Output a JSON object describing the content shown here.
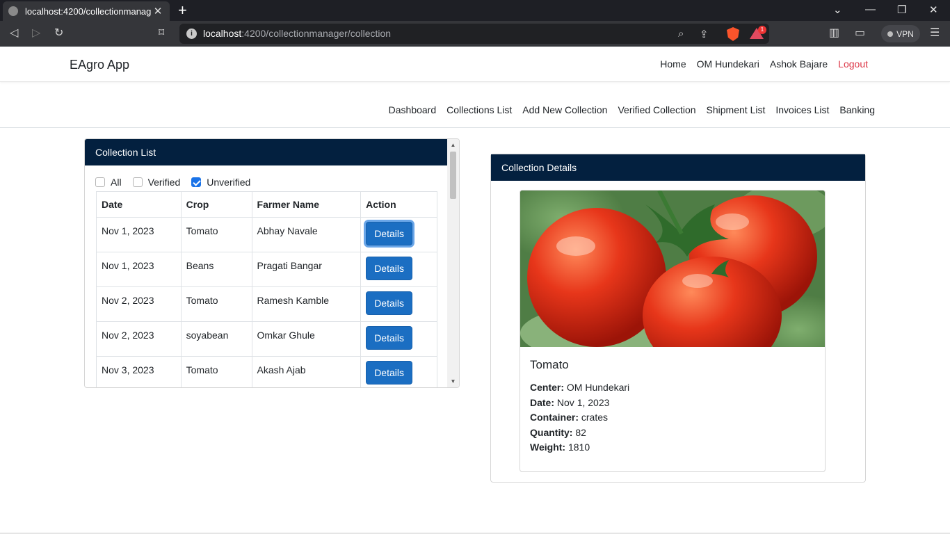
{
  "browser": {
    "tab_title": "localhost:4200/collectionmanage",
    "url_host": "localhost",
    "url_path": ":4200/collectionmanager/collection",
    "vpn_label": "VPN",
    "notification_count": "1"
  },
  "navbar": {
    "brand": "EAgro App",
    "links": [
      "Home",
      "OM Hundekari",
      "Ashok Bajare"
    ],
    "logout": "Logout"
  },
  "subnav": {
    "links": [
      "Dashboard",
      "Collections List",
      "Add New Collection",
      "Verified Collection",
      "Shipment List",
      "Invoices List",
      "Banking"
    ]
  },
  "collection_list": {
    "title": "Collection List",
    "filters": [
      {
        "label": "All",
        "checked": false
      },
      {
        "label": "Verified",
        "checked": false
      },
      {
        "label": "Unverified",
        "checked": true
      }
    ],
    "columns": [
      "Date",
      "Crop",
      "Farmer Name",
      "Action"
    ],
    "rows": [
      {
        "date": "Nov 1, 2023",
        "crop": "Tomato",
        "farmer": "Abhay Navale",
        "action": "Details"
      },
      {
        "date": "Nov 1, 2023",
        "crop": "Beans",
        "farmer": "Pragati Bangar",
        "action": "Details"
      },
      {
        "date": "Nov 2, 2023",
        "crop": "Tomato",
        "farmer": "Ramesh Kamble",
        "action": "Details"
      },
      {
        "date": "Nov 2, 2023",
        "crop": "soyabean",
        "farmer": "Omkar Ghule",
        "action": "Details"
      },
      {
        "date": "Nov 3, 2023",
        "crop": "Tomato",
        "farmer": "Akash Ajab",
        "action": "Details"
      }
    ]
  },
  "collection_details": {
    "title": "Collection Details",
    "crop": "Tomato",
    "fields": [
      {
        "label": "Center:",
        "value": "OM Hundekari"
      },
      {
        "label": "Date:",
        "value": "Nov 1, 2023"
      },
      {
        "label": "Container:",
        "value": "crates"
      },
      {
        "label": "Quantity:",
        "value": "82"
      },
      {
        "label": "Weight:",
        "value": "1810"
      }
    ]
  },
  "colors": {
    "card_header": "#03203f",
    "primary_button": "#1b6ec2",
    "logout": "#dc3545"
  }
}
